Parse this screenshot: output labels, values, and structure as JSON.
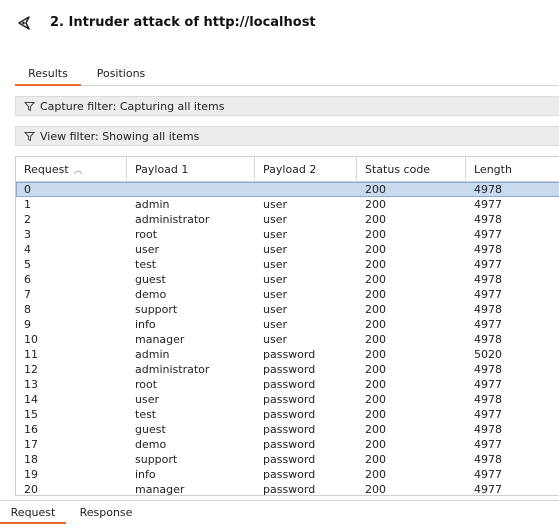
{
  "window": {
    "title": "2. Intruder attack of http://localhost",
    "icon": "intruder-icon"
  },
  "tabs": [
    {
      "label": "Results",
      "active": true
    },
    {
      "label": "Positions",
      "active": false
    }
  ],
  "capture_filter": {
    "label": "Capture filter: Capturing all items",
    "icon": "filter-icon"
  },
  "view_filter": {
    "label": "View filter: Showing all items",
    "icon": "filter-icon"
  },
  "table": {
    "columns": [
      "Request",
      "Payload 1",
      "Payload 2",
      "Status code",
      "Length"
    ],
    "sort_column": "Request",
    "sort_direction": "ascending",
    "selected_row": 0,
    "rows": [
      [
        "0",
        "",
        "",
        "200",
        "4978"
      ],
      [
        "1",
        "admin",
        "user",
        "200",
        "4977"
      ],
      [
        "2",
        "administrator",
        "user",
        "200",
        "4978"
      ],
      [
        "3",
        "root",
        "user",
        "200",
        "4977"
      ],
      [
        "4",
        "user",
        "user",
        "200",
        "4978"
      ],
      [
        "5",
        "test",
        "user",
        "200",
        "4977"
      ],
      [
        "6",
        "guest",
        "user",
        "200",
        "4978"
      ],
      [
        "7",
        "demo",
        "user",
        "200",
        "4977"
      ],
      [
        "8",
        "support",
        "user",
        "200",
        "4978"
      ],
      [
        "9",
        "info",
        "user",
        "200",
        "4977"
      ],
      [
        "10",
        "manager",
        "user",
        "200",
        "4978"
      ],
      [
        "11",
        "admin",
        "password",
        "200",
        "5020"
      ],
      [
        "12",
        "administrator",
        "password",
        "200",
        "4978"
      ],
      [
        "13",
        "root",
        "password",
        "200",
        "4977"
      ],
      [
        "14",
        "user",
        "password",
        "200",
        "4978"
      ],
      [
        "15",
        "test",
        "password",
        "200",
        "4977"
      ],
      [
        "16",
        "guest",
        "password",
        "200",
        "4978"
      ],
      [
        "17",
        "demo",
        "password",
        "200",
        "4977"
      ],
      [
        "18",
        "support",
        "password",
        "200",
        "4978"
      ],
      [
        "19",
        "info",
        "password",
        "200",
        "4977"
      ],
      [
        "20",
        "manager",
        "password",
        "200",
        "4977"
      ]
    ]
  },
  "bottom_tabs": [
    {
      "label": "Request",
      "active": true
    },
    {
      "label": "Response",
      "active": false
    }
  ],
  "colors": {
    "accent": "#e8692a",
    "selection": "#c9d9ee",
    "filter_bg": "#ececec"
  }
}
